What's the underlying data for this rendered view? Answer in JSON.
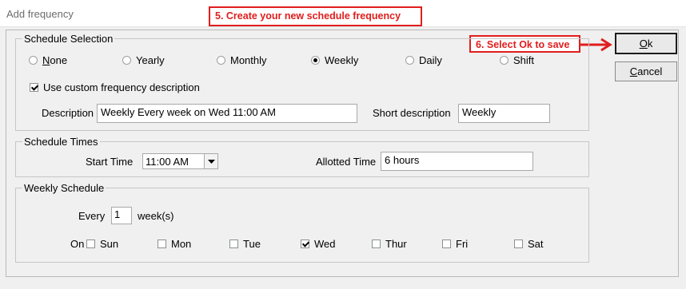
{
  "window": {
    "title": "Add frequency"
  },
  "callouts": {
    "step5": "5. Create your new schedule frequency",
    "step6": "6. Select Ok to save"
  },
  "buttons": {
    "ok": "Ok",
    "cancel": "Cancel"
  },
  "schedule_selection": {
    "legend": "Schedule Selection",
    "options": [
      "None",
      "Yearly",
      "Monthly",
      "Weekly",
      "Daily",
      "Shift"
    ],
    "selected": "Weekly",
    "custom_description_label": "Use custom frequency description",
    "custom_description_checked": true,
    "description_label": "Description",
    "description_value": "Weekly Every week on Wed 11:00 AM",
    "short_description_label": "Short description",
    "short_description_value": "Weekly"
  },
  "schedule_times": {
    "legend": "Schedule Times",
    "start_time_label": "Start Time",
    "start_time_value": "11:00 AM",
    "allotted_time_label": "Allotted Time",
    "allotted_time_value": "6 hours"
  },
  "weekly_schedule": {
    "legend": "Weekly Schedule",
    "every_label": "Every",
    "every_value": "1",
    "every_unit": "week(s)",
    "on_label": "On",
    "days": [
      {
        "label": "Sun",
        "checked": false
      },
      {
        "label": "Mon",
        "checked": false
      },
      {
        "label": "Tue",
        "checked": false
      },
      {
        "label": "Wed",
        "checked": true
      },
      {
        "label": "Thur",
        "checked": false
      },
      {
        "label": "Fri",
        "checked": false
      },
      {
        "label": "Sat",
        "checked": false
      }
    ]
  },
  "colors": {
    "callout": "#e11d1d",
    "background": "#f0f0f0"
  }
}
